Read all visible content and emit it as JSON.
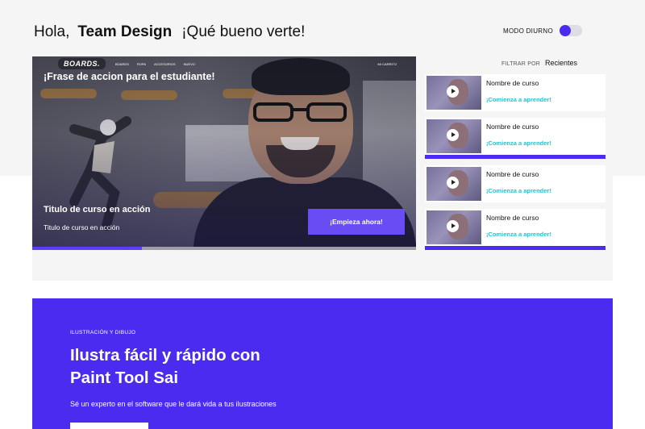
{
  "header": {
    "greeting": "Hola,",
    "user_name": "Team Design",
    "welcome": "¡Qué bueno verte!",
    "mode_label": "MODO DIURNO"
  },
  "hero": {
    "logo": "BOARDS.",
    "nav_links": [
      "BOARDS",
      "ROPA",
      "ACCESORIOS",
      "NUEVO"
    ],
    "cart_label": "MI CARRITO",
    "phrase": "¡Frase de accion para el estudiante!",
    "course_title": "Titulo de curso en acción",
    "course_subtitle": "Titulo de curso en acción",
    "cta_label": "¡Empieza ahora!",
    "progress": 0.285
  },
  "courses": {
    "filter_label": "FILTRAR POR",
    "filter_value": "Recientes",
    "items": [
      {
        "name": "Nombre de curso",
        "link": "¡Comienza a aprender!",
        "active": false
      },
      {
        "name": "Nombre de curso",
        "link": "¡Comienza a aprender!",
        "active": true
      },
      {
        "name": "Nombre de curso",
        "link": "¡Comienza a aprender!",
        "active": false
      },
      {
        "name": "Nombre de curso",
        "link": "¡Comienza a aprender!",
        "active": true
      }
    ]
  },
  "promo": {
    "eyebrow": "ILUSTRACIÓN Y DIBUJO",
    "headline_line1": "Ilustra fácil y rápido con",
    "headline_line2": "Paint Tool Sai",
    "description": "Sé un experto en el software que le dará vida a tus ilustraciones"
  },
  "colors": {
    "accent": "#4b2bf0",
    "cta": "#6a4cf5",
    "link": "#19c7d6",
    "background_band": "#f5f5f6"
  }
}
